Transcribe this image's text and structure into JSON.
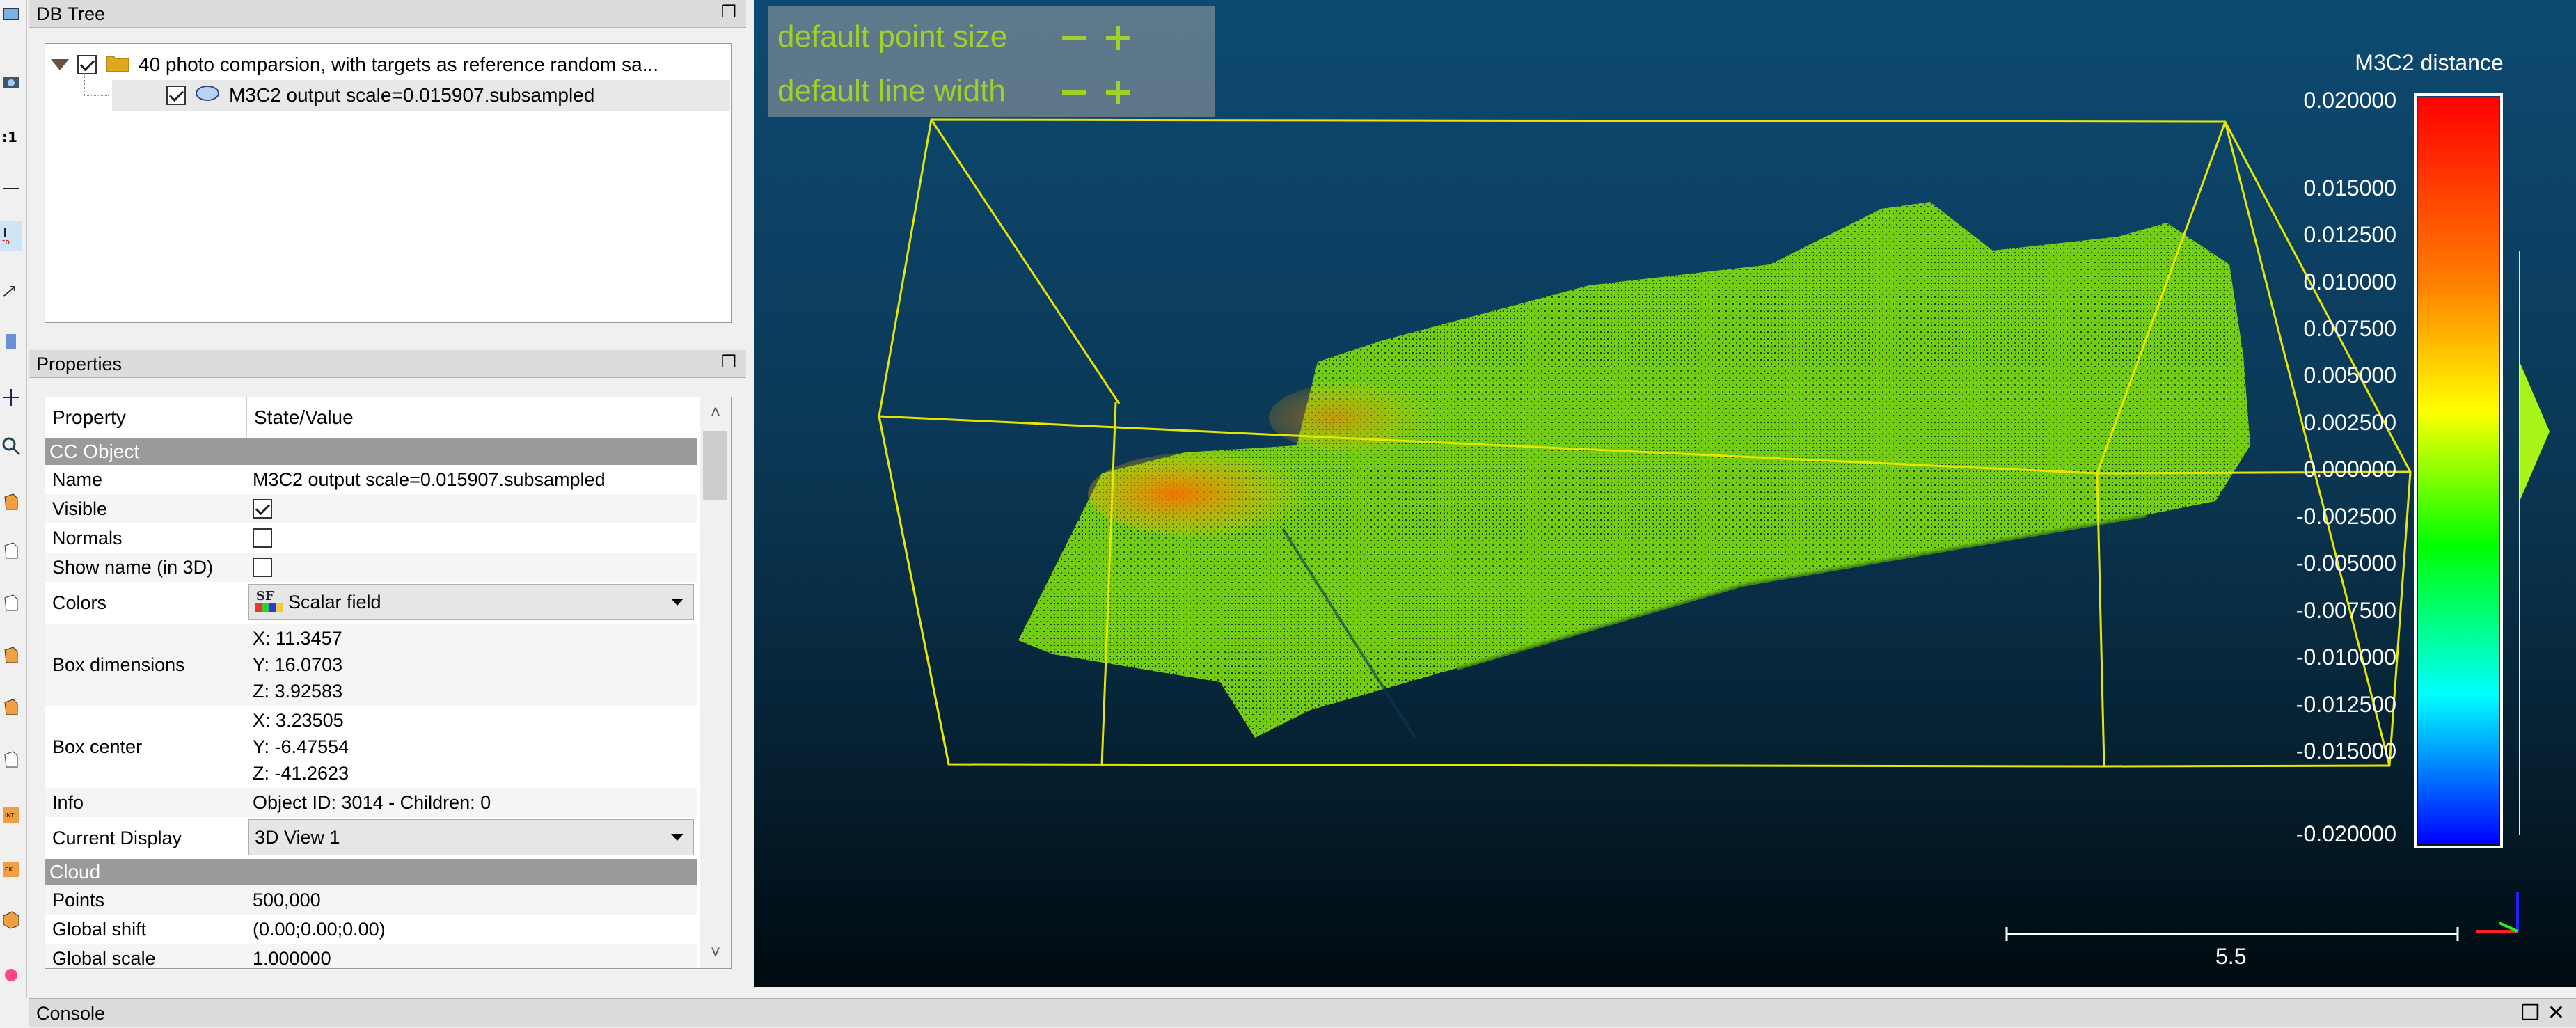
{
  "db_tree": {
    "title": "DB Tree",
    "items": [
      {
        "label": "40 photo comparsion, with targets  as reference random sa...",
        "checked": true,
        "icon": "folder-icon"
      },
      {
        "label": "M3C2 output scale=0.015907.subsampled",
        "checked": true,
        "icon": "point-cloud-icon"
      }
    ]
  },
  "properties": {
    "title": "Properties",
    "header": {
      "property": "Property",
      "value": "State/Value"
    },
    "sections": [
      {
        "name": "CC Object",
        "rows": [
          {
            "key": "Name",
            "value": "M3C2 output scale=0.015907.subsampled"
          },
          {
            "key": "Visible",
            "checkbox": true
          },
          {
            "key": "Normals",
            "checkbox": false
          },
          {
            "key": "Show name (in 3D)",
            "checkbox": false
          },
          {
            "key": "Colors",
            "combo": "Scalar field",
            "combo_icon": "SF"
          },
          {
            "key": "Box dimensions",
            "lines": [
              "X: 11.3457",
              "Y: 16.0703",
              "Z: 3.92583"
            ]
          },
          {
            "key": "Box center",
            "lines": [
              "X: 3.23505",
              "Y: -6.47554",
              "Z: -41.2623"
            ]
          },
          {
            "key": "Info",
            "value": "Object ID: 3014 - Children: 0"
          },
          {
            "key": "Current Display",
            "combo": "3D View 1"
          }
        ]
      },
      {
        "name": "Cloud",
        "rows": [
          {
            "key": "Points",
            "value": "500,000"
          },
          {
            "key": "Global shift",
            "value": "(0.00;0.00;0.00)"
          },
          {
            "key": "Global scale",
            "value": "1.000000"
          }
        ]
      }
    ]
  },
  "view3d": {
    "hud": {
      "point_size_label": "default point size",
      "line_width_label": "default line width"
    },
    "scalar_bar": {
      "title": "M3C2 distance",
      "ticks": [
        "0.020000",
        "0.015000",
        "0.012500",
        "0.010000",
        "0.007500",
        "0.005000",
        "0.002500",
        "0.000000",
        "-0.002500",
        "-0.005000",
        "-0.007500",
        "-0.010000",
        "-0.012500",
        "-0.015000",
        "-0.020000"
      ],
      "colors": [
        "#ff0000",
        "#ff8000",
        "#ffff00",
        "#00ff00",
        "#00ffff",
        "#0000ff"
      ]
    },
    "scale_label": "5.5",
    "bbox_color": "#e6e600"
  },
  "console": {
    "title": "Console"
  },
  "colors": {
    "point_cloud_main": "#7ed60a",
    "highlight": "#ff8c00"
  }
}
